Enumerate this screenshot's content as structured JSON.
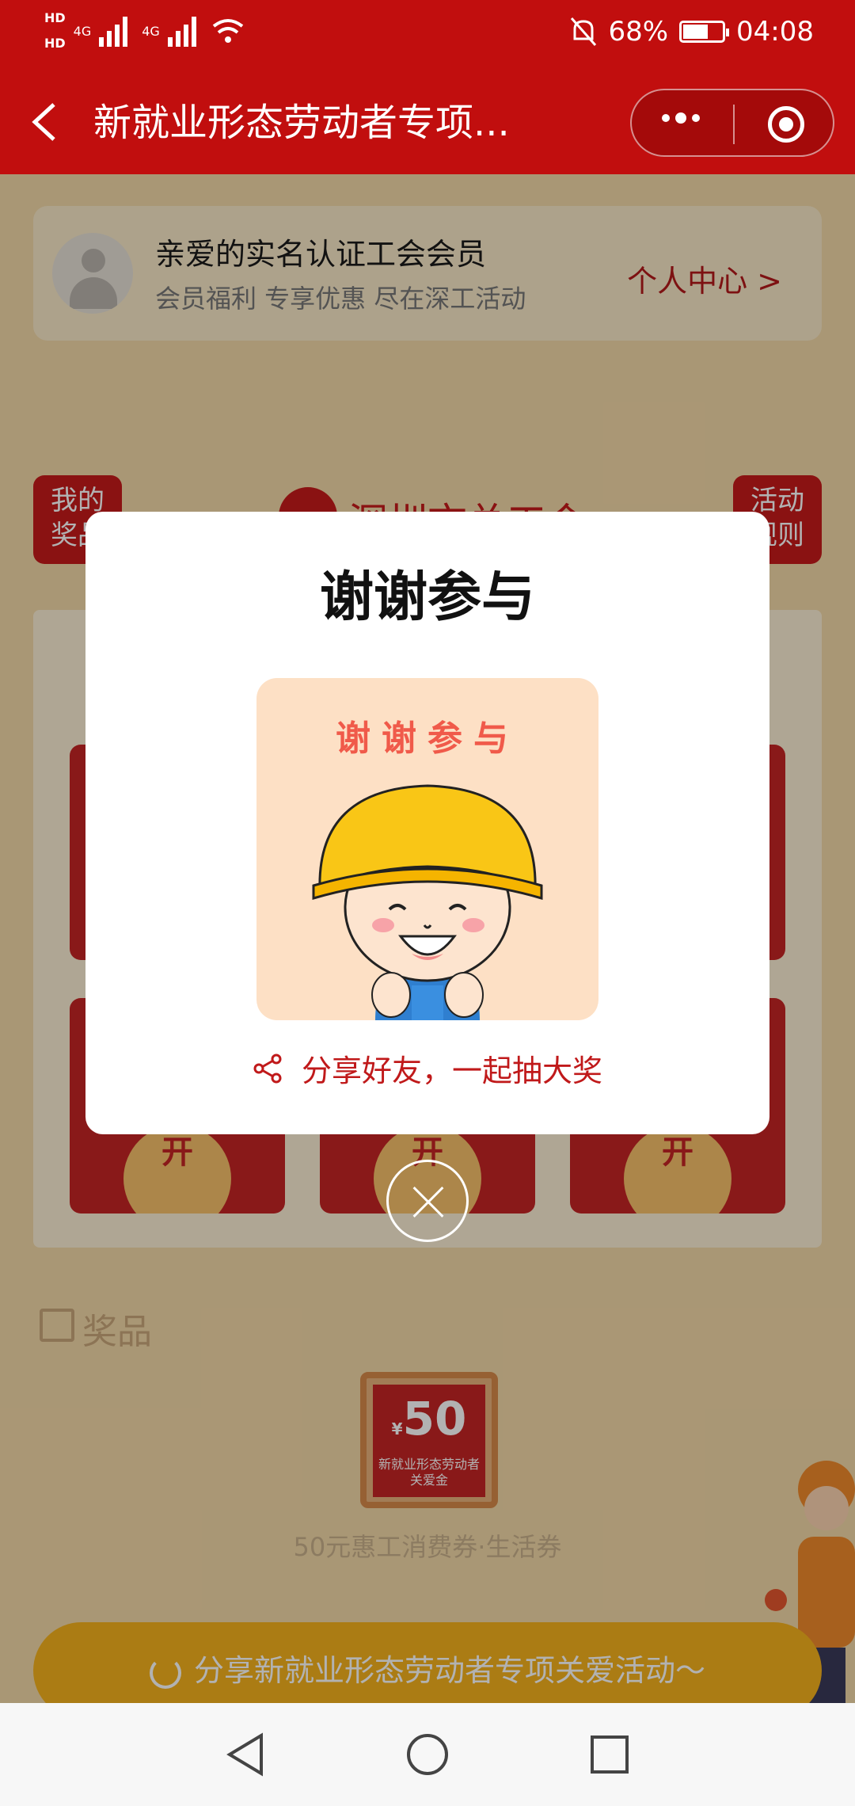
{
  "status_bar": {
    "hd1": "HD",
    "hd2": "HD",
    "net1": "4G",
    "net2": "4G",
    "battery": "68%",
    "time": "04:08"
  },
  "nav": {
    "title": "新就业形态劳动者专项..."
  },
  "member_card": {
    "title": "亲爱的实名认证工会会员",
    "subtitle": "会员福利 专享优惠 尽在深工活动",
    "link": "个人中心 >"
  },
  "side_badges": {
    "left": [
      "我的",
      "奖品"
    ],
    "right": [
      "活动",
      "规则"
    ]
  },
  "header_logo_text": "深圳市总工会",
  "grid": {
    "cells": [
      "开",
      "开",
      "开"
    ]
  },
  "prizes": {
    "title": "奖品",
    "coupon": {
      "currency": "¥",
      "amount": "50",
      "line1": "新就业形态劳动者",
      "line2": "关爱金"
    },
    "name": "50元惠工消费券·生活券"
  },
  "share_bar": {
    "label": "分享新就业形态劳动者专项关爱活动～"
  },
  "dialog": {
    "title": "谢谢参与",
    "image_text": "谢谢参与",
    "share_text": "分享好友，一起抽大奖"
  },
  "colors": {
    "brand_red": "#c10e0e",
    "accent_red": "#c0191a",
    "share_yellow": "#f5b21e"
  }
}
